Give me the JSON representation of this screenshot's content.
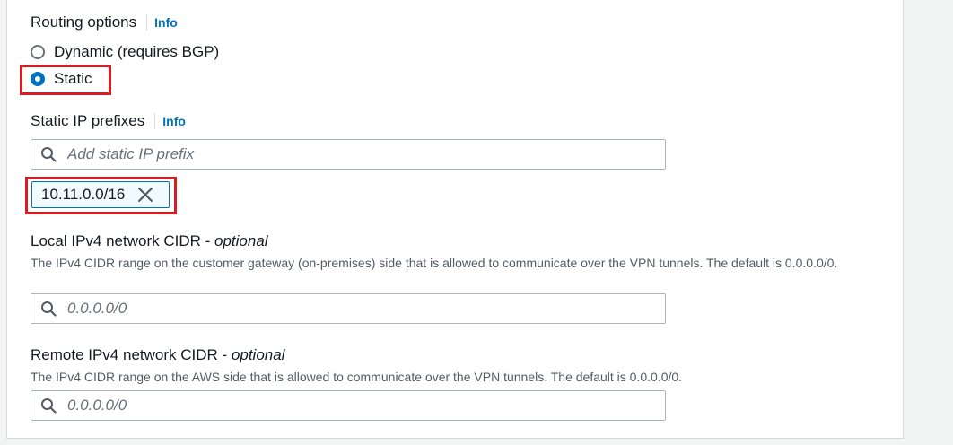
{
  "routing": {
    "label": "Routing options",
    "info": "Info",
    "options": [
      {
        "label": "Dynamic (requires BGP)",
        "checked": false
      },
      {
        "label": "Static",
        "checked": true
      }
    ]
  },
  "static_prefixes": {
    "label": "Static IP prefixes",
    "info": "Info",
    "placeholder": "Add static IP prefix",
    "tokens": [
      "10.11.0.0/16"
    ]
  },
  "local_cidr": {
    "label": "Local IPv4 network CIDR - ",
    "optional": "optional",
    "description": "The IPv4 CIDR range on the customer gateway (on-premises) side that is allowed to communicate over the VPN tunnels. The default is 0.0.0.0/0.",
    "placeholder": "0.0.0.0/0"
  },
  "remote_cidr": {
    "label": "Remote IPv4 network CIDR - ",
    "optional": "optional",
    "description": "The IPv4 CIDR range on the AWS side that is allowed to communicate over the VPN tunnels. The default is 0.0.0.0/0.",
    "placeholder": "0.0.0.0/0"
  },
  "colors": {
    "accent": "#0073bb",
    "highlight": "#d91c22"
  }
}
